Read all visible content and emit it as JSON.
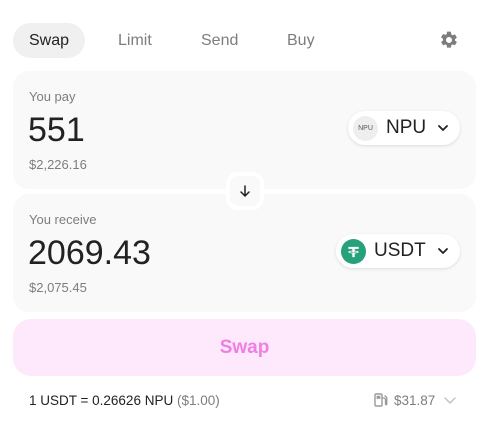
{
  "tabs": [
    {
      "label": "Swap",
      "active": true
    },
    {
      "label": "Limit",
      "active": false
    },
    {
      "label": "Send",
      "active": false
    },
    {
      "label": "Buy",
      "active": false
    }
  ],
  "pay": {
    "label": "You pay",
    "amount": "551",
    "fiat": "$2,226.16",
    "token": {
      "symbol": "NPU",
      "icon_text": "NPU"
    }
  },
  "receive": {
    "label": "You receive",
    "amount": "2069.43",
    "fiat": "$2,075.45",
    "token": {
      "symbol": "USDT",
      "icon": "tether-icon"
    }
  },
  "swap_button": {
    "label": "Swap"
  },
  "footer": {
    "rate": "1 USDT = 0.26626 NPU",
    "rate_usd": "($1.00)",
    "gas": "$31.87"
  },
  "colors": {
    "accent_pink": "#f07fe3",
    "swap_bg": "#fde9fb",
    "panel_bg": "#f9f9f9",
    "tether_green": "#26a17b"
  }
}
